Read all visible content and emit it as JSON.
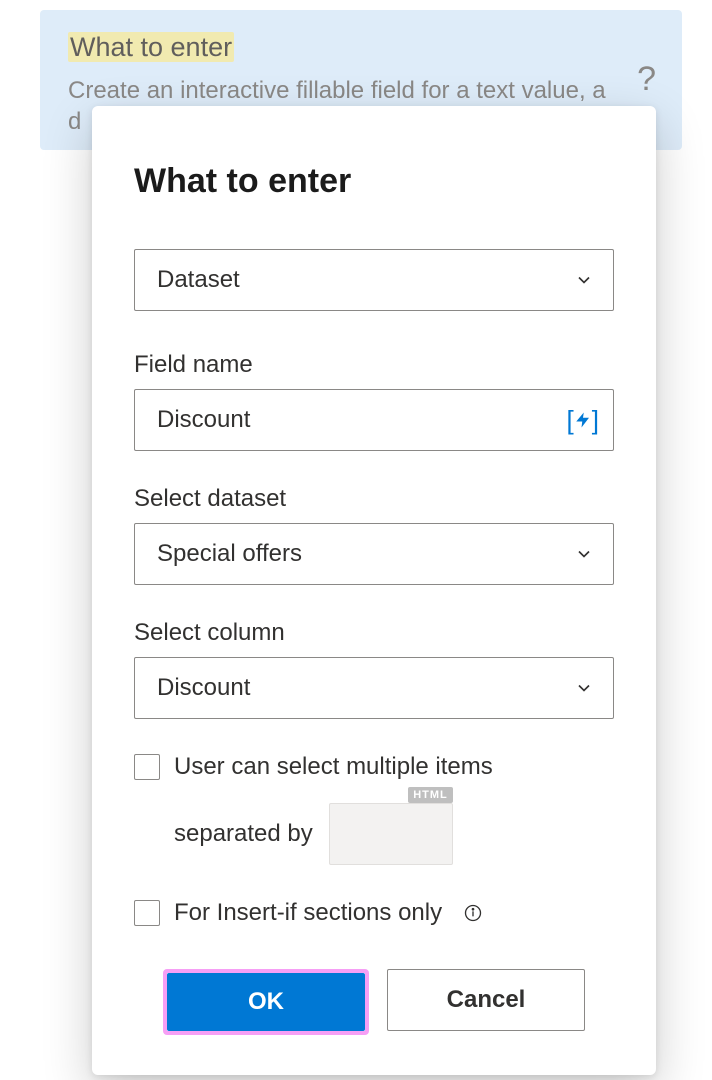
{
  "background": {
    "title": "What to enter",
    "description": "Create an interactive fillable field for a text value, a d",
    "help": "?"
  },
  "modal": {
    "title": "What to enter",
    "type_select": {
      "value": "Dataset"
    },
    "field_name": {
      "label": "Field name",
      "value": "Discount"
    },
    "select_dataset": {
      "label": "Select dataset",
      "value": "Special offers"
    },
    "select_column": {
      "label": "Select column",
      "value": "Discount"
    },
    "multi": {
      "label": "User can select multiple items"
    },
    "separated": {
      "label": "separated by",
      "badge": "HTML"
    },
    "insert_if": {
      "label": "For Insert-if sections only"
    },
    "buttons": {
      "ok": "OK",
      "cancel": "Cancel"
    }
  }
}
